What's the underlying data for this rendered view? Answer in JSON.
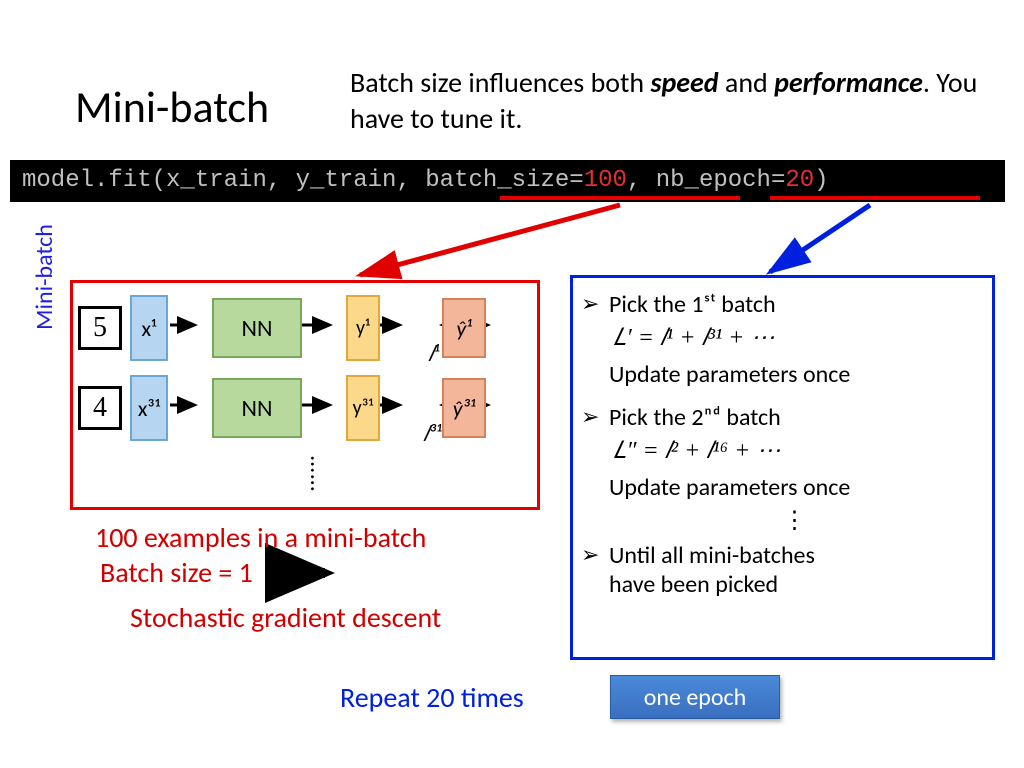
{
  "slide": {
    "title": "Mini-batch",
    "subtitle_plain1": "Batch size influences both ",
    "subtitle_em1": "speed",
    "subtitle_plain2": " and ",
    "subtitle_em2": "performance",
    "subtitle_plain3": ". You have to tune it."
  },
  "code": {
    "prefix": "model.fit(x_train, y_train, ",
    "bs_key": "batch_size=",
    "bs_val": "100",
    "comma": ", ",
    "ep_key": "nb_epoch=",
    "ep_val": "20",
    "close": ")"
  },
  "diagram": {
    "side_label": "Mini-batch",
    "hw1": "5",
    "hw2": "4",
    "x1": "x¹",
    "x31": "x³¹",
    "nn": "NN",
    "y1": "y¹",
    "y31": "y³¹",
    "yh1": "ŷ¹",
    "yh31": "ŷ³¹",
    "l1": "𝑙¹",
    "l31": "𝑙³¹",
    "vdots": "……"
  },
  "captions": {
    "c1": "100 examples in a mini-batch",
    "c2": "Batch size = 1",
    "c3": "Stochastic gradient descent"
  },
  "steps": {
    "s1": "Pick the 1ˢᵗ batch",
    "eq1": "𝐿′ = 𝑙¹ + 𝑙³¹ + ⋯",
    "u1": "Update parameters once",
    "s2": "Pick the 2ⁿᵈ batch",
    "eq2": "𝐿″ = 𝑙² + 𝑙¹⁶ + ⋯",
    "u2": "Update parameters once",
    "dots": "⋮",
    "s3a": "Until all mini-batches",
    "s3b": "have been picked"
  },
  "footer": {
    "repeat": "Repeat 20 times",
    "epoch": "one epoch"
  }
}
